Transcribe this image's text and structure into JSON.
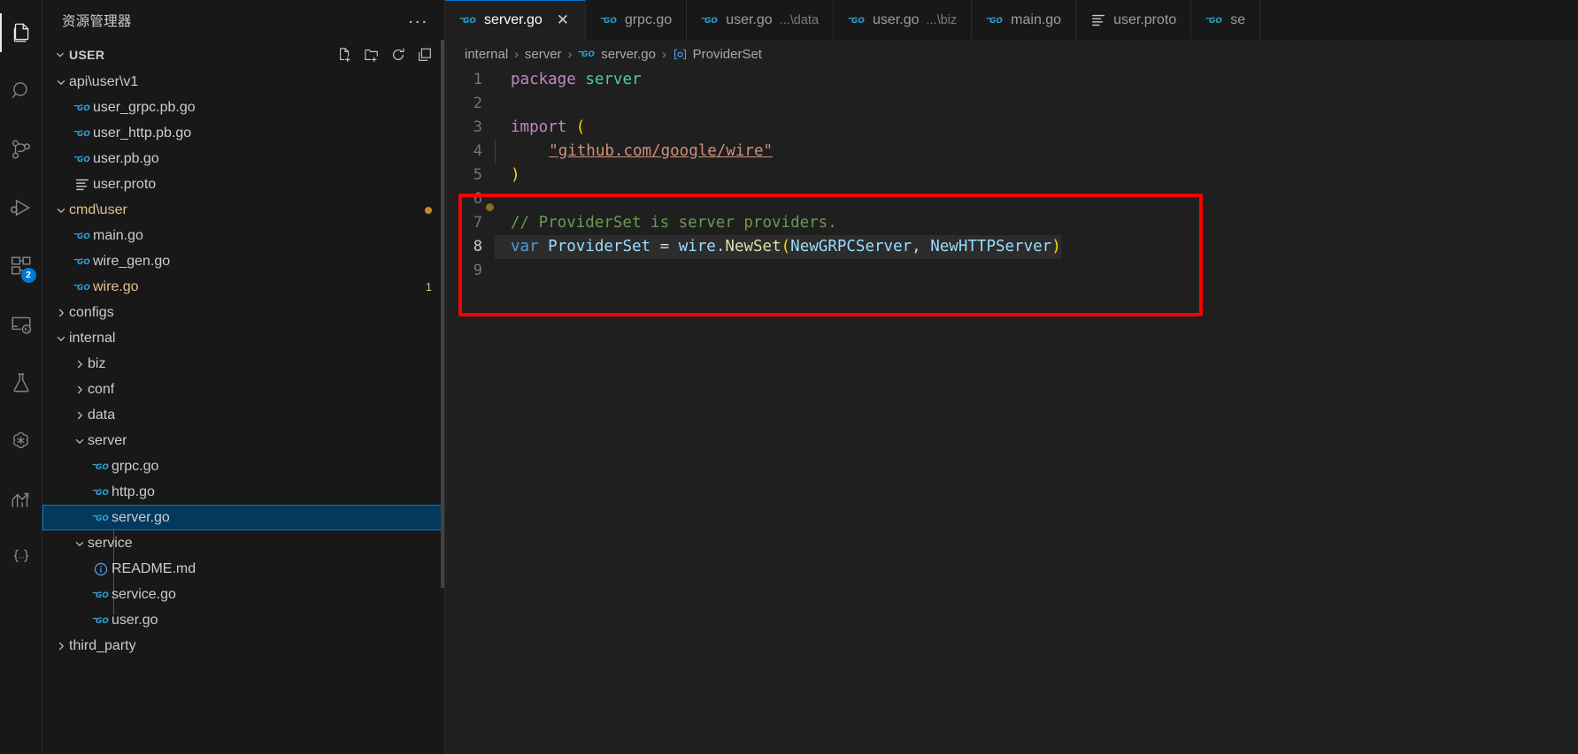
{
  "activitybar": {
    "items": [
      {
        "name": "explorer",
        "icon": "files-icon",
        "active": true,
        "badge": null
      },
      {
        "name": "search",
        "icon": "search-icon",
        "active": false,
        "badge": null
      },
      {
        "name": "source-control",
        "icon": "source-control-icon",
        "active": false,
        "badge": null
      },
      {
        "name": "run-and-debug",
        "icon": "run-debug-icon",
        "active": false,
        "badge": null
      },
      {
        "name": "extensions",
        "icon": "extensions-icon",
        "active": false,
        "badge": "2"
      },
      {
        "name": "remote-explorer",
        "icon": "remote-terminal-icon",
        "active": false,
        "badge": null
      },
      {
        "name": "testing",
        "icon": "beaker-icon",
        "active": false,
        "badge": null
      },
      {
        "name": "chatgpt",
        "icon": "openai-icon",
        "active": false,
        "badge": null
      },
      {
        "name": "analytics",
        "icon": "chart-arrow-icon",
        "active": false,
        "badge": null
      },
      {
        "name": "json-tools",
        "icon": "braces-icon",
        "active": false,
        "badge": null
      }
    ]
  },
  "sidebar": {
    "title": "资源管理器",
    "overflow_label": "...",
    "section": {
      "label": "USER",
      "expanded": true,
      "actions": [
        {
          "name": "new-file-icon",
          "tooltip": "新建文件"
        },
        {
          "name": "new-folder-icon",
          "tooltip": "新建文件夹"
        },
        {
          "name": "refresh-icon",
          "tooltip": "刷新"
        },
        {
          "name": "collapse-all-icon",
          "tooltip": "全部折叠"
        }
      ]
    },
    "tree": [
      {
        "label": "api\\user\\v1",
        "type": "folder",
        "expanded": true,
        "depth": 1,
        "icon": "chevron-down-icon",
        "modified": false,
        "badge": null
      },
      {
        "label": "user_grpc.pb.go",
        "type": "file",
        "depth": 2,
        "icon": "go-file-icon",
        "modified": false,
        "badge": null
      },
      {
        "label": "user_http.pb.go",
        "type": "file",
        "depth": 2,
        "icon": "go-file-icon",
        "modified": false,
        "badge": null
      },
      {
        "label": "user.pb.go",
        "type": "file",
        "depth": 2,
        "icon": "go-file-icon",
        "modified": false,
        "badge": null
      },
      {
        "label": "user.proto",
        "type": "file",
        "depth": 2,
        "icon": "proto-file-icon",
        "modified": false,
        "badge": null
      },
      {
        "label": "cmd\\user",
        "type": "folder",
        "expanded": true,
        "depth": 1,
        "icon": "chevron-down-icon",
        "modified": true,
        "badge": "dot"
      },
      {
        "label": "main.go",
        "type": "file",
        "depth": 2,
        "icon": "go-file-icon",
        "modified": false,
        "badge": null
      },
      {
        "label": "wire_gen.go",
        "type": "file",
        "depth": 2,
        "icon": "go-file-icon",
        "modified": false,
        "badge": null
      },
      {
        "label": "wire.go",
        "type": "file",
        "depth": 2,
        "icon": "go-file-icon",
        "modified": true,
        "badge": "1"
      },
      {
        "label": "configs",
        "type": "folder",
        "expanded": false,
        "depth": 1,
        "icon": "chevron-right-icon",
        "modified": false,
        "badge": null
      },
      {
        "label": "internal",
        "type": "folder",
        "expanded": true,
        "depth": 1,
        "icon": "chevron-down-icon",
        "modified": false,
        "badge": null
      },
      {
        "label": "biz",
        "type": "folder",
        "expanded": false,
        "depth": 2,
        "icon": "chevron-right-icon",
        "modified": false,
        "badge": null
      },
      {
        "label": "conf",
        "type": "folder",
        "expanded": false,
        "depth": 2,
        "icon": "chevron-right-icon",
        "modified": false,
        "badge": null
      },
      {
        "label": "data",
        "type": "folder",
        "expanded": false,
        "depth": 2,
        "icon": "chevron-right-icon",
        "modified": false,
        "badge": null
      },
      {
        "label": "server",
        "type": "folder",
        "expanded": true,
        "depth": 2,
        "icon": "chevron-down-icon",
        "modified": false,
        "badge": null
      },
      {
        "label": "grpc.go",
        "type": "file",
        "depth": 3,
        "icon": "go-file-icon",
        "modified": false,
        "badge": null
      },
      {
        "label": "http.go",
        "type": "file",
        "depth": 3,
        "icon": "go-file-icon",
        "modified": false,
        "badge": null
      },
      {
        "label": "server.go",
        "type": "file",
        "depth": 3,
        "icon": "go-file-icon",
        "modified": false,
        "badge": null,
        "selected": true
      },
      {
        "label": "service",
        "type": "folder",
        "expanded": true,
        "depth": 2,
        "icon": "chevron-down-icon",
        "modified": false,
        "badge": null
      },
      {
        "label": "README.md",
        "type": "file",
        "depth": 3,
        "icon": "info-file-icon",
        "modified": false,
        "badge": null
      },
      {
        "label": "service.go",
        "type": "file",
        "depth": 3,
        "icon": "go-file-icon",
        "modified": false,
        "badge": null
      },
      {
        "label": "user.go",
        "type": "file",
        "depth": 3,
        "icon": "go-file-icon",
        "modified": false,
        "badge": null
      },
      {
        "label": "third_party",
        "type": "folder",
        "expanded": false,
        "depth": 1,
        "icon": "chevron-right-icon",
        "modified": false,
        "badge": null
      }
    ]
  },
  "tabs": [
    {
      "name": "server.go",
      "description": "",
      "icon": "go-file-icon",
      "active": true,
      "close_label": "✕"
    },
    {
      "name": "grpc.go",
      "description": "",
      "icon": "go-file-icon",
      "active": false
    },
    {
      "name": "user.go",
      "description": "...\\data",
      "icon": "go-file-icon",
      "active": false
    },
    {
      "name": "user.go",
      "description": "...\\biz",
      "icon": "go-file-icon",
      "active": false
    },
    {
      "name": "main.go",
      "description": "",
      "icon": "go-file-icon",
      "active": false
    },
    {
      "name": "user.proto",
      "description": "",
      "icon": "proto-file-icon",
      "active": false
    },
    {
      "name": "se",
      "description": "",
      "icon": "go-file-icon",
      "active": false
    }
  ],
  "breadcrumb": [
    {
      "label": "internal",
      "icon": null
    },
    {
      "label": "server",
      "icon": null
    },
    {
      "label": "server.go",
      "icon": "go-file-icon"
    },
    {
      "label": "ProviderSet",
      "icon": "symbol-variable-icon"
    }
  ],
  "breadcrumb_separator": "›",
  "code": {
    "language": "go",
    "lines": [
      {
        "no": "1",
        "text": "package server"
      },
      {
        "no": "2",
        "text": ""
      },
      {
        "no": "3",
        "text": "import ("
      },
      {
        "no": "4",
        "text": "    \"github.com/google/wire\""
      },
      {
        "no": "5",
        "text": ")"
      },
      {
        "no": "6",
        "text": ""
      },
      {
        "no": "7",
        "text": "// ProviderSet is server providers."
      },
      {
        "no": "8",
        "text": "var ProviderSet = wire.NewSet(NewGRPCServer, NewHTTPServer)"
      },
      {
        "no": "9",
        "text": ""
      }
    ]
  },
  "annotation": {
    "shape": "rectangle",
    "color": "#fe0000",
    "covers_lines": [
      "6",
      "7",
      "8",
      "9"
    ]
  },
  "colors": {
    "accent": "#0078d4",
    "selection": "#04395e",
    "modified": "#e2c08d",
    "annotation": "#fe0000",
    "editor_bg": "#1f1f1f",
    "sidebar_bg": "#181818"
  }
}
